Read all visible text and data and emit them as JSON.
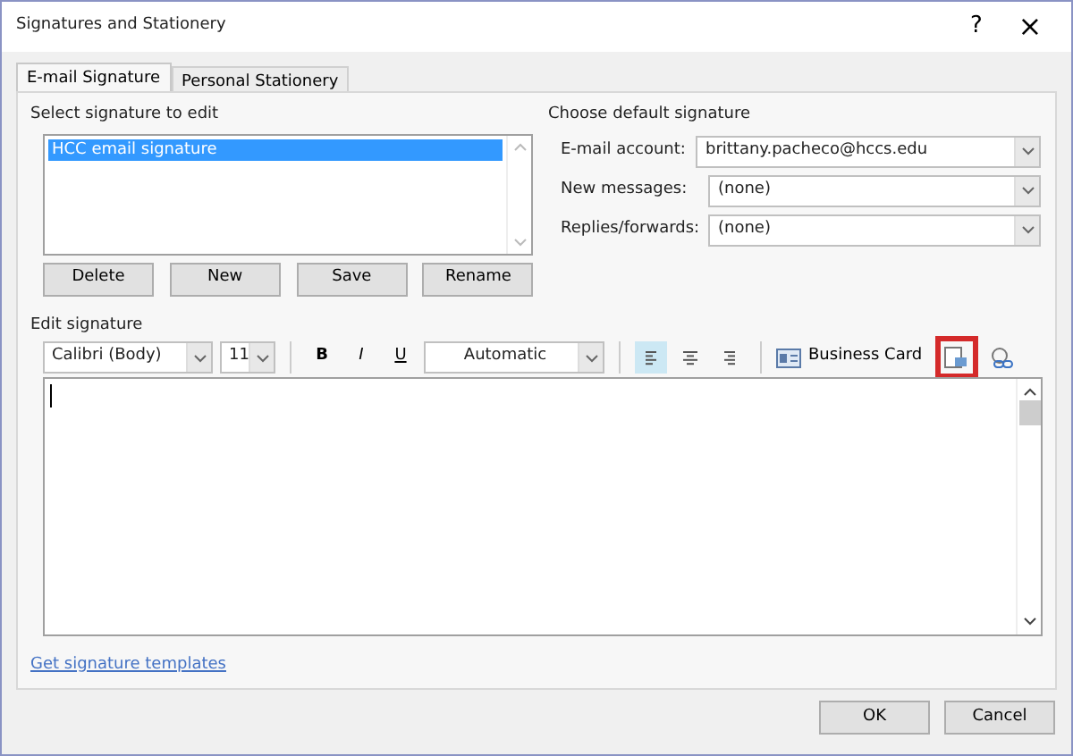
{
  "window": {
    "title": "Signatures and Stationery",
    "help": "?",
    "close": "×"
  },
  "tabs": [
    {
      "label": "E-mail Signature",
      "selected": true
    },
    {
      "label": "Personal Stationery",
      "selected": false
    }
  ],
  "select_signature": {
    "label": "Select signature to edit",
    "items": [
      {
        "label": "HCC email signature",
        "selected": true
      }
    ],
    "buttons": [
      "Delete",
      "New",
      "Save",
      "Rename"
    ]
  },
  "default_signature": {
    "label": "Choose default signature",
    "fields": [
      {
        "label": "E-mail account:",
        "value": "brittany.pacheco@hccs.edu"
      },
      {
        "label": "New messages:",
        "value": "(none)"
      },
      {
        "label": "Replies/forwards:",
        "value": "(none)"
      }
    ]
  },
  "edit_signature": {
    "label": "Edit signature",
    "font": "Calibri (Body)",
    "size": "11",
    "bold": "B",
    "italic": "I",
    "underline": "U",
    "font_color": "Automatic",
    "align": [
      {
        "kind": "left",
        "selected": true
      },
      {
        "kind": "center",
        "selected": false
      },
      {
        "kind": "right",
        "selected": false
      }
    ],
    "business_card": "Business Card",
    "insert_picture": {
      "highlighted": true
    }
  },
  "link": "Get signature templates",
  "buttons": [
    "OK",
    "Cancel"
  ]
}
